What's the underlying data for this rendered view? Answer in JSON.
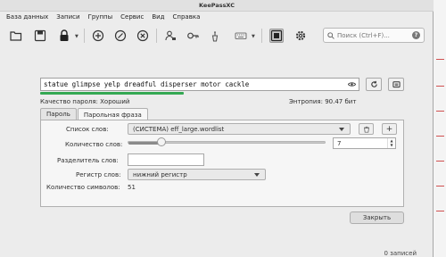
{
  "window": {
    "title": "KeePassXC"
  },
  "menu": [
    "База данных",
    "Записи",
    "Группы",
    "Сервис",
    "Вид",
    "Справка"
  ],
  "search": {
    "placeholder": "Поиск (Ctrl+F)...",
    "help": "?"
  },
  "generator": {
    "password": "statue glimpse yelp dreadful disperser motor cackle",
    "quality_label": "Качество пароля: Хороший",
    "entropy_label": "Энтропия: 90.47 бит",
    "quality_fraction": 0.45,
    "strength_color": "#34a853",
    "tabs": [
      "Пароль",
      "Парольная фраза"
    ],
    "active_tab": "Парольная фраза",
    "wordlist_label": "Список слов:",
    "wordlist_value": "(СИСТЕМА) eff_large.wordlist",
    "word_count_label": "Количество слов:",
    "word_count_value": "7",
    "separator_label": "Разделитель слов:",
    "separator_value": "",
    "case_label": "Регистр слов:",
    "case_value": "нижний регистр",
    "char_count_label": "Количество символов:",
    "char_count_value": "51",
    "close_label": "Закрыть",
    "add_symbol": "+"
  },
  "status": {
    "entries": "0 записей"
  },
  "icons": [
    "folder-open-icon",
    "save-icon",
    "lock-icon",
    "add-entry-icon",
    "edit-entry-icon",
    "delete-entry-icon",
    "copy-username-icon",
    "copy-password-icon",
    "autotype-keyboard-icon",
    "password-generator-icon",
    "settings-gear-icon",
    "search-icon",
    "eye-icon",
    "regenerate-icon",
    "copy-icon",
    "trash-icon"
  ]
}
